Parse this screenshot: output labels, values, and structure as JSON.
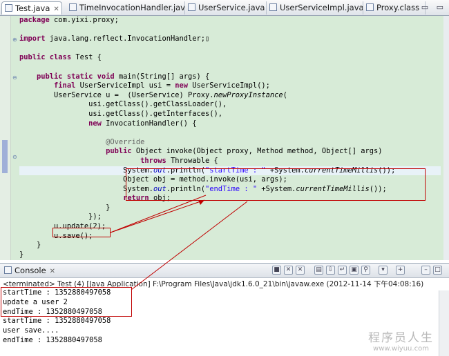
{
  "tabs": [
    {
      "label": "Test.java",
      "active": true
    },
    {
      "label": "TimeInvocationHandler.java"
    },
    {
      "label": "UserService.java"
    },
    {
      "label": "UserServiceImpl.java"
    },
    {
      "label": "Proxy.class"
    }
  ],
  "tab_close_glyph": "✕",
  "window_controls": "▭ ▭",
  "editor": {
    "lines": [
      "package com.yixi.proxy;",
      "",
      "import java.lang.reflect.InvocationHandler;",
      "",
      "public class Test {",
      "",
      "    public static void main(String[] args) {",
      "        final UserServiceImpl usi = new UserServiceImpl();",
      "        UserService u =  (UserService) Proxy.newProxyInstance(",
      "                usi.getClass().getClassLoader(),",
      "                usi.getClass().getInterfaces(),",
      "                new InvocationHandler() {",
      "",
      "                    @Override",
      "                    public Object invoke(Object proxy, Method method, Object[] args)",
      "                            throws Throwable {",
      "                        System.out.println(\"startTime : \" +System.currentTimeMillis());",
      "                        Object obj = method.invoke(usi, args);",
      "                        System.out.println(\"endTime : \" +System.currentTimeMillis());",
      "                        return obj;",
      "                    }",
      "                });",
      "        u.update(2);",
      "        u.save();",
      "    }",
      "}"
    ]
  },
  "console": {
    "title": "Console",
    "tab_close_glyph": "✕",
    "status": "<terminated> Test (4) [Java Application] F:\\Program Files\\Java\\jdk1.6.0_21\\bin\\javaw.exe (2012-11-14 下午04:08:16)",
    "output": [
      "startTime : 1352880497058",
      "update a user 2",
      "endTime : 1352880497058",
      "startTime : 1352880497058",
      "user save....",
      "endTime : 1352880497058"
    ]
  },
  "watermark": {
    "line1": "程序员人生",
    "line2": "www.wiyuu.com"
  },
  "colors": {
    "annotation_red": "#c00000",
    "editor_bg": "#d7ebd7",
    "keyword": "#7f0055",
    "string": "#2a00ff"
  }
}
